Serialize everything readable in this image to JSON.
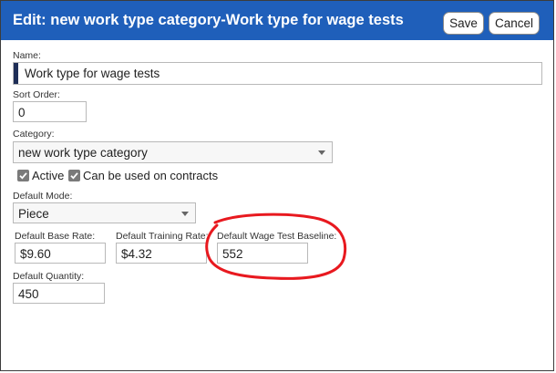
{
  "dialog": {
    "title": "Edit: new work type category-Work type for wage tests",
    "save_label": "Save",
    "cancel_label": "Cancel"
  },
  "form": {
    "name": {
      "label": "Name:",
      "value": "Work type for wage tests"
    },
    "sort_order": {
      "label": "Sort Order:",
      "value": "0"
    },
    "category": {
      "label": "Category:",
      "value": "new work type category"
    },
    "active": {
      "label": "Active",
      "checked": true
    },
    "contracts": {
      "label": "Can be used on contracts",
      "checked": true
    },
    "default_mode": {
      "label": "Default Mode:",
      "value": "Piece"
    },
    "base_rate": {
      "label": "Default Base Rate:",
      "value": "$9.60"
    },
    "training_rate": {
      "label": "Default Training Rate:",
      "value": "$4.32"
    },
    "wage_test_baseline": {
      "label": "Default Wage Test Baseline:",
      "value": "552"
    },
    "quantity": {
      "label": "Default Quantity:",
      "value": "450"
    }
  },
  "colors": {
    "titlebar": "#1f5fba",
    "annotation": "#e8191f"
  }
}
